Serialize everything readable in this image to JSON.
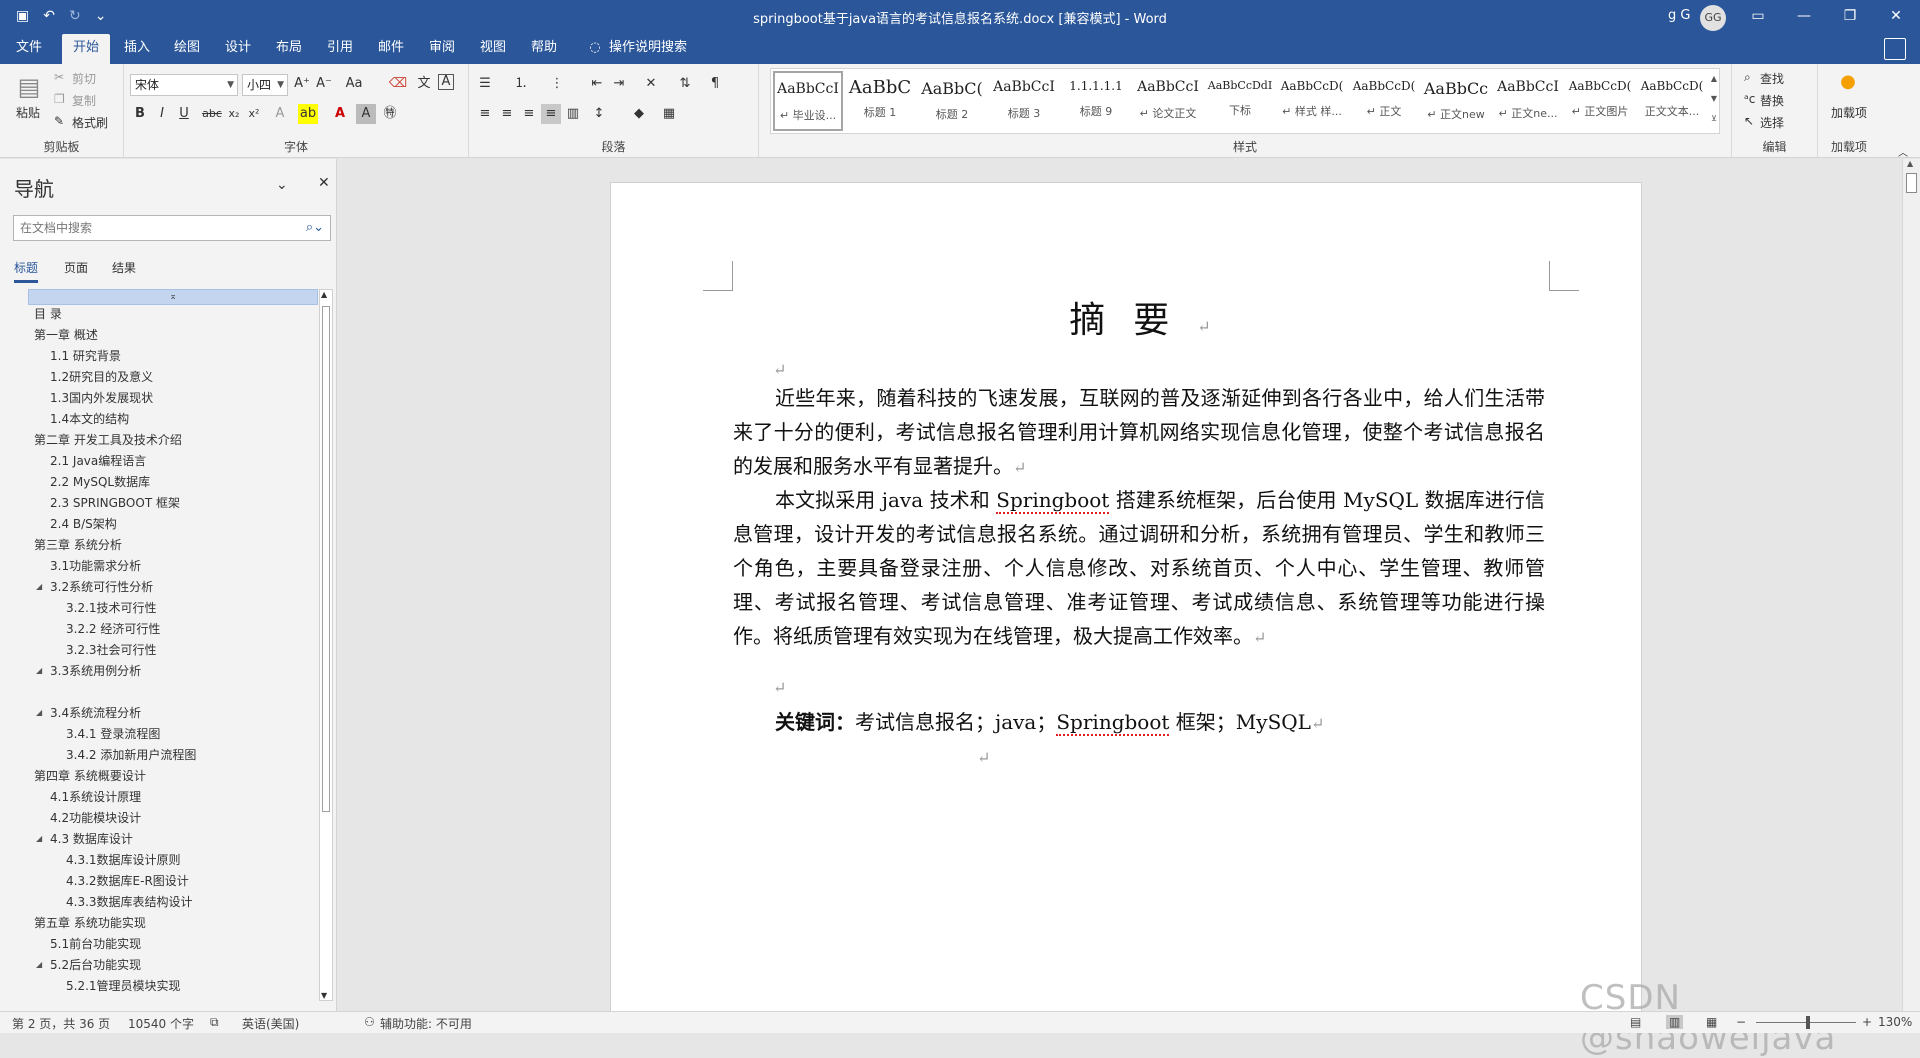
{
  "window": {
    "title": "springboot基于java语言的考试信息报名系统.docx [兼容模式] - Word",
    "user_name": "g G",
    "avatar_initials": "GG"
  },
  "ribbon_tabs": [
    "文件",
    "开始",
    "插入",
    "绘图",
    "设计",
    "布局",
    "引用",
    "邮件",
    "审阅",
    "视图",
    "帮助",
    "操作说明搜索"
  ],
  "ribbon": {
    "clipboard": {
      "paste": "粘贴",
      "cut": "剪切",
      "copy": "复制",
      "format_painter": "格式刷",
      "label": "剪贴板"
    },
    "font": {
      "font_name": "宋体",
      "font_size": "小四",
      "label": "字体"
    },
    "paragraph": {
      "label": "段落"
    },
    "styles": {
      "label": "样式",
      "items": [
        {
          "sample": "AaBbCcI",
          "name": "↵ 毕业设..."
        },
        {
          "sample": "AaBbC",
          "name": "标题 1"
        },
        {
          "sample": "AaBbC(",
          "name": "标题 2"
        },
        {
          "sample": "AaBbCcI",
          "name": "标题 3"
        },
        {
          "sample": "1.1.1.1.1",
          "name": "标题 9"
        },
        {
          "sample": "AaBbCcI",
          "name": "↵ 论文正文"
        },
        {
          "sample": "AaBbCcDdI",
          "name": "下标"
        },
        {
          "sample": "AaBbCcD(",
          "name": "↵ 样式 样..."
        },
        {
          "sample": "AaBbCcD(",
          "name": "↵ 正文"
        },
        {
          "sample": "AaBbCc",
          "name": "↵ 正文new"
        },
        {
          "sample": "AaBbCcI",
          "name": "↵ 正文ne..."
        },
        {
          "sample": "AaBbCcD(",
          "name": "↵ 正文图片"
        },
        {
          "sample": "AaBbCcD(",
          "name": "正文文本..."
        }
      ]
    },
    "editing": {
      "find": "查找",
      "replace": "替换",
      "select": "选择",
      "label": "编辑"
    },
    "addins": {
      "button": "加载项",
      "label": "加载项"
    }
  },
  "nav": {
    "title": "导航",
    "search_placeholder": "在文档中搜索",
    "tabs": [
      "标题",
      "页面",
      "结果"
    ],
    "outline": [
      {
        "text": "目 录",
        "level": 1,
        "expand": false
      },
      {
        "text": "第一章 概述",
        "level": 1,
        "expand": true
      },
      {
        "text": "1.1 研究背景",
        "level": 2,
        "expand": false
      },
      {
        "text": "1.2研究目的及意义",
        "level": 2,
        "expand": false
      },
      {
        "text": "1.3国内外发展现状",
        "level": 2,
        "expand": false
      },
      {
        "text": "1.4本文的结构",
        "level": 2,
        "expand": false
      },
      {
        "text": "第二章 开发工具及技术介绍",
        "level": 1,
        "expand": true
      },
      {
        "text": "2.1 Java编程语言",
        "level": 2,
        "expand": false
      },
      {
        "text": "2.2 MySQL数据库",
        "level": 2,
        "expand": false
      },
      {
        "text": "2.3 SPRINGBOOT 框架",
        "level": 2,
        "expand": false
      },
      {
        "text": "2.4 B/S架构",
        "level": 2,
        "expand": false
      },
      {
        "text": "第三章 系统分析",
        "level": 1,
        "expand": true
      },
      {
        "text": "3.1功能需求分析",
        "level": 2,
        "expand": false
      },
      {
        "text": "3.2系统可行性分析",
        "level": 2,
        "expand": true
      },
      {
        "text": "3.2.1技术可行性",
        "level": 3,
        "expand": false
      },
      {
        "text": "3.2.2 经济可行性",
        "level": 3,
        "expand": false
      },
      {
        "text": "3.2.3社会可行性",
        "level": 3,
        "expand": false
      },
      {
        "text": "3.3系统用例分析",
        "level": 2,
        "expand": true
      },
      {
        "text": "",
        "level": 2,
        "expand": false
      },
      {
        "text": "3.4系统流程分析",
        "level": 2,
        "expand": true
      },
      {
        "text": "3.4.1 登录流程图",
        "level": 3,
        "expand": false
      },
      {
        "text": "3.4.2 添加新用户流程图",
        "level": 3,
        "expand": false
      },
      {
        "text": "第四章 系统概要设计",
        "level": 1,
        "expand": true
      },
      {
        "text": "4.1系统设计原理",
        "level": 2,
        "expand": false
      },
      {
        "text": "4.2功能模块设计",
        "level": 2,
        "expand": false
      },
      {
        "text": "4.3 数据库设计",
        "level": 2,
        "expand": true
      },
      {
        "text": "4.3.1数据库设计原则",
        "level": 3,
        "expand": false
      },
      {
        "text": "4.3.2数据库E-R图设计",
        "level": 3,
        "expand": false
      },
      {
        "text": "4.3.3数据库表结构设计",
        "level": 3,
        "expand": false
      },
      {
        "text": "第五章 系统功能实现",
        "level": 1,
        "expand": true
      },
      {
        "text": "5.1前台功能实现",
        "level": 2,
        "expand": false
      },
      {
        "text": "5.2后台功能实现",
        "level": 2,
        "expand": true
      },
      {
        "text": "5.2.1管理员模块实现",
        "level": 3,
        "expand": false
      }
    ]
  },
  "document": {
    "heading": "摘要",
    "para1": "近些年来，随着科技的飞速发展，互联网的普及逐渐延伸到各行各业中，给人们生活带来了十分的便利，考试信息报名管理利用计算机网络实现信息化管理，使整个考试信息报名的发展和服务水平有显著提升。",
    "para2_a": "本文拟采用 java 技术和 ",
    "para2_b": "Springboot",
    "para2_c": " 搭建系统框架，后台使用 MySQL 数据库进行信息管理，设计开发的考试信息报名系统。通过调研和分析，系统拥有管理员、学生和教师三个角色，主要具备登录注册、个人信息修改、对系统首页、个人中心、学生管理、教师管理、考试报名管理、考试信息管理、准考证管理、考试成绩信息、系统管理等功能进行操作。将纸质管理有效实现为在线管理，极大提高工作效率。",
    "kw_label": "关键词：",
    "kw_a": "考试信息报名；java；",
    "kw_b": "Springboot",
    "kw_c": " 框架；MySQL",
    "para_mark": "↵"
  },
  "status": {
    "page": "第 2 页，共 36 页",
    "words": "10540 个字",
    "language": "英语(美国)",
    "accessibility": "辅助功能: 不可用",
    "zoom": "130%"
  },
  "watermark": "CSDN @shaoweijava",
  "colors": {
    "brand": "#2b579a",
    "ribbon": "#f3f3f3",
    "canvas": "#e6e6e6"
  }
}
